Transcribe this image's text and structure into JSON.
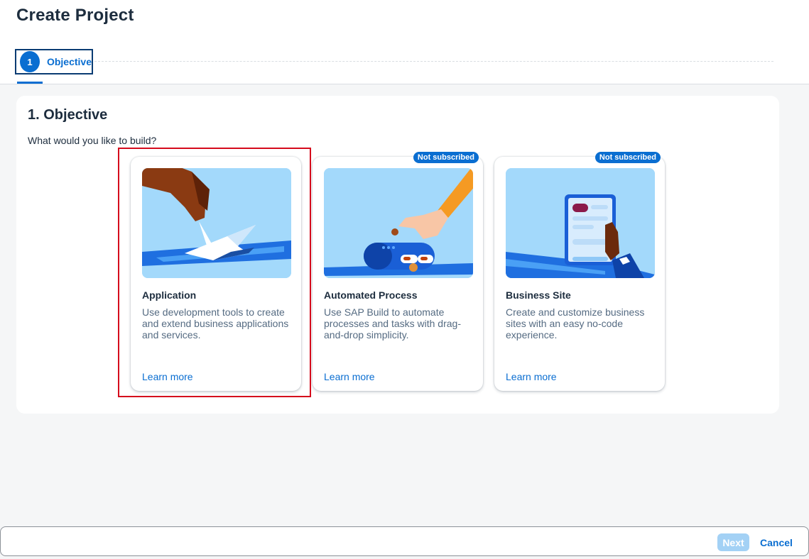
{
  "header": {
    "title": "Create Project",
    "steps": [
      {
        "number": "1",
        "label": "Objective"
      }
    ]
  },
  "main": {
    "section_title": "1. Objective",
    "question": "What would you like to build?",
    "cards": [
      {
        "title": "Application",
        "description": "Use development tools to create and extend business applications and services.",
        "link": "Learn more",
        "badge": "",
        "image_icon": "crane-origami-icon"
      },
      {
        "title": "Automated Process",
        "description": "Use SAP Build to automate processes and tasks with drag-and-drop simplicity.",
        "link": "Learn more",
        "badge": "Not subscribed",
        "image_icon": "robot-hand-icon"
      },
      {
        "title": "Business Site",
        "description": "Create and customize business sites with an easy no-code experience.",
        "link": "Learn more",
        "badge": "Not subscribed",
        "image_icon": "tablet-hand-icon"
      }
    ]
  },
  "footer": {
    "next_label": "Next",
    "cancel_label": "Cancel"
  },
  "colors": {
    "accent": "#0a6ed1",
    "highlight": "#d50a1c",
    "illustration_bg": "#a3d9fb"
  }
}
